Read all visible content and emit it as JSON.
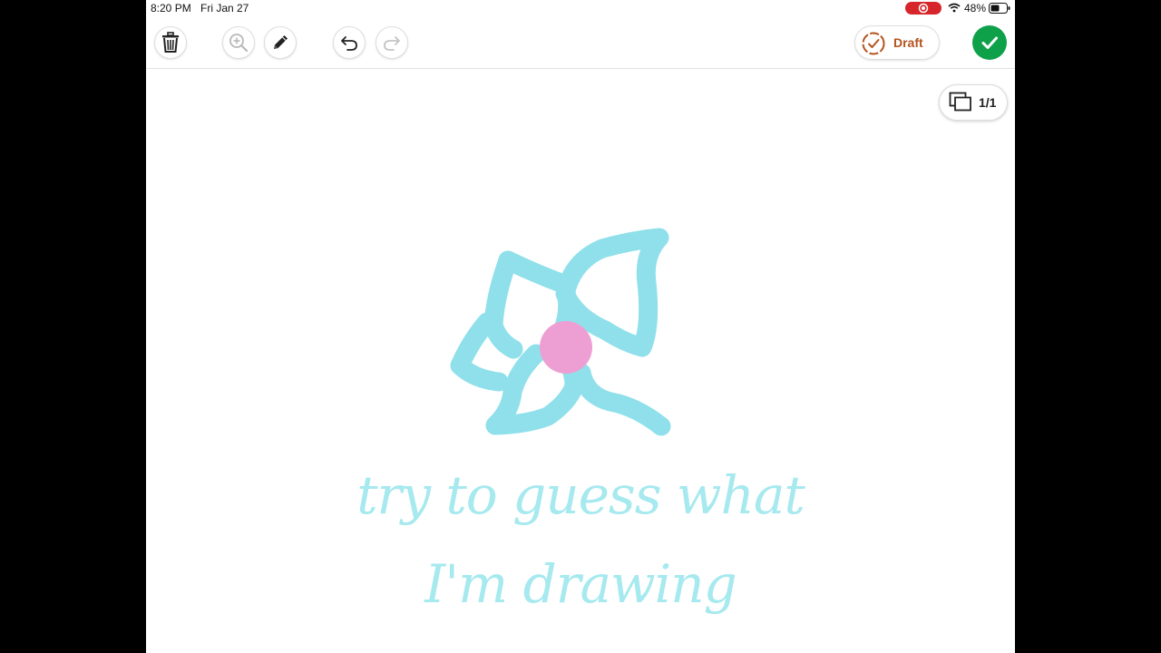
{
  "status_bar": {
    "time": "8:20 PM",
    "date": "Fri Jan 27",
    "battery": "48%"
  },
  "toolbar": {
    "draft_label": "Draft"
  },
  "canvas": {
    "page_counter": "1/1",
    "caption_line1": "try to guess what",
    "caption_line2": "I'm drawing"
  },
  "colors": {
    "stroke": "#8fe0ea",
    "center": "#ed9fd3",
    "draft": "#b4531f",
    "confirm": "#0fa14a",
    "record": "#d7262b"
  }
}
